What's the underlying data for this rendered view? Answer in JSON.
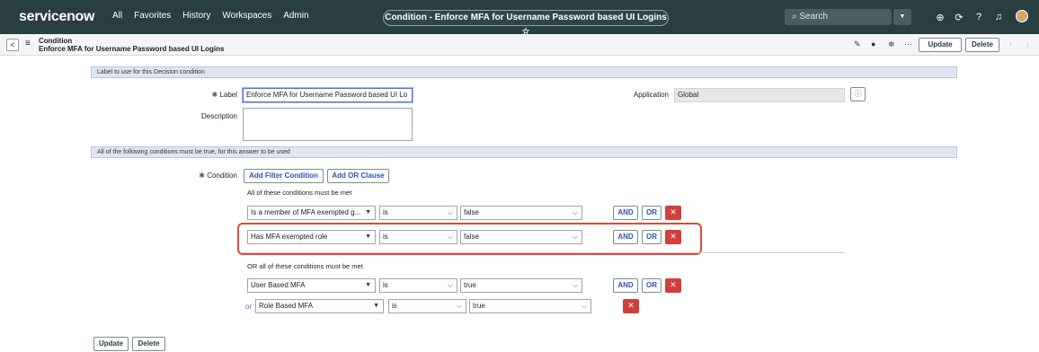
{
  "topnav": {
    "logo": "servicenow",
    "links": [
      "All",
      "Favorites",
      "History",
      "Workspaces",
      "Admin"
    ],
    "title": "Condition - Enforce MFA for Username Password based UI Logins ☆",
    "search_placeholder": "Search",
    "icons": [
      "globe-icon",
      "share-icon",
      "help-icon",
      "bell-icon",
      "avatar"
    ]
  },
  "subbar": {
    "back": "<",
    "line1": "Condition",
    "line2": "Enforce MFA for Username Password based UI Logins",
    "update": "Update",
    "delete": "Delete"
  },
  "form": {
    "section1": "Label to use for this Decision condition",
    "label_label": "Label",
    "label_value": "Enforce MFA for Username Password based UI Lo",
    "description_label": "Description",
    "application_label": "Application",
    "application_value": "Global",
    "section2": "All of the following conditions must be true, for this answer to be used",
    "condition_label": "Condition",
    "add_filter": "Add Filter Condition",
    "add_or": "Add OR Clause",
    "all_met": "All of these conditions must be met",
    "or_all_met": "OR all of these conditions must be met",
    "rows": [
      {
        "field": "Is a member of MFA exempted g...",
        "op": "is",
        "value": "false"
      },
      {
        "field": "Has MFA exempted role",
        "op": "is",
        "value": "false"
      },
      {
        "field": "User Based MFA",
        "op": "is",
        "value": "true"
      },
      {
        "field": "Role Based MFA",
        "op": "is",
        "value": "true"
      }
    ],
    "and": "AND",
    "or": "OR",
    "or_prefix": "or",
    "x": "✕"
  },
  "footer": {
    "update": "Update",
    "delete": "Delete"
  },
  "colors": {
    "nav": "#293e40",
    "accent": "#2e52b8",
    "danger": "#d13f3b",
    "highlight": "#e2493a"
  }
}
